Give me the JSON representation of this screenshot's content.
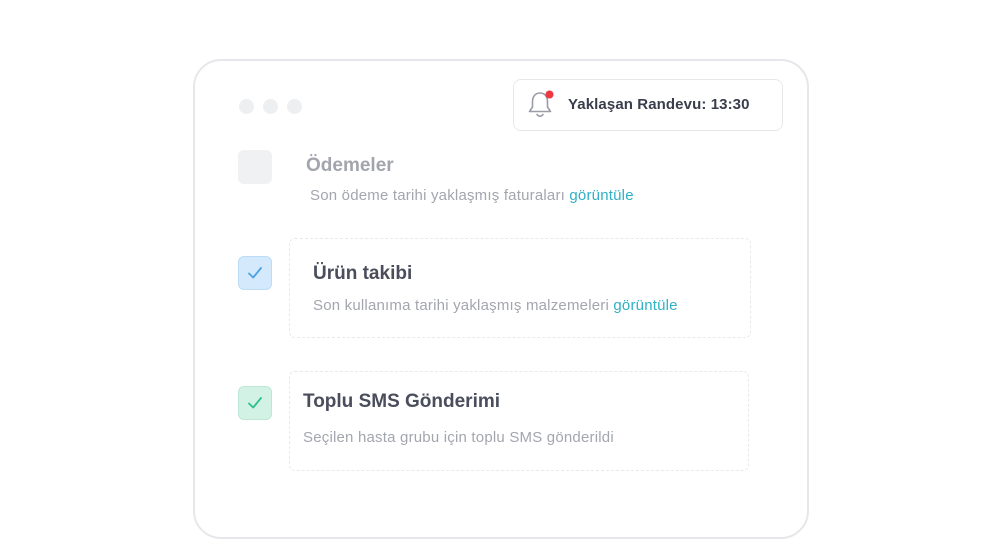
{
  "notification": {
    "text": "Yaklaşan Randevu: 13:30",
    "icon": "bell-icon",
    "dot_color": "#f0373f"
  },
  "tasks": [
    {
      "title": "Ödemeler",
      "description": "Son ödeme tarihi yaklaşmış faturaları",
      "link": "görüntüle",
      "checked": false
    },
    {
      "title": "Ürün takibi",
      "description": "Son kullanıma tarihi yaklaşmış malzemeleri",
      "link": "görüntüle",
      "checked": true,
      "check_color": "#4aa3e0"
    },
    {
      "title": "Toplu SMS Gönderimi",
      "description": "Seçilen hasta grubu için toplu SMS gönderildi",
      "checked": true,
      "check_color": "#2ec08e"
    }
  ],
  "colors": {
    "link": "#2fb1c4",
    "title_dark": "#4a4d5c",
    "title_muted": "#a3a5ae"
  }
}
